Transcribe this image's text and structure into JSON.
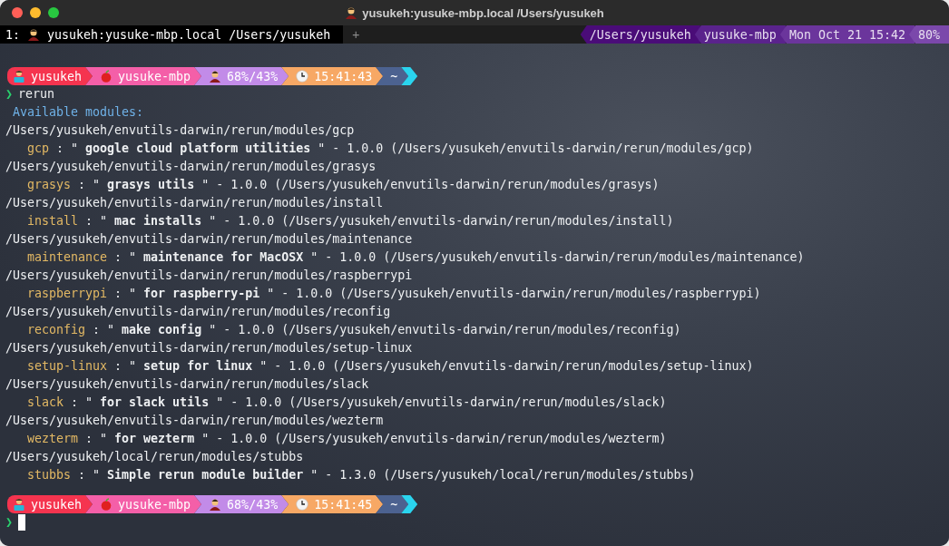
{
  "window": {
    "title": "yusukeh:yusuke-mbp.local /Users/yusukeh"
  },
  "tab_bar": {
    "tabs": [
      {
        "index": "1:",
        "title": "yusukeh:yusuke-mbp.local /Users/yusukeh",
        "selected": true
      }
    ],
    "new_tab": "+",
    "status": [
      {
        "text": "/Users/yusukeh",
        "color": "#4a0c78"
      },
      {
        "text": "yusuke-mbp",
        "color": "#5a238c"
      },
      {
        "text": "Mon Oct 21 15:42",
        "color": "#6b359c"
      },
      {
        "text": "80%",
        "color": "#7b48ab"
      }
    ]
  },
  "prompt": {
    "segments": [
      {
        "kind": "user",
        "text": "yusukeh",
        "color": "#f5344f"
      },
      {
        "kind": "host",
        "text": "yusuke-mbp",
        "color": "#f45fa8"
      },
      {
        "kind": "memory",
        "text": "68%/43%",
        "color": "#c28be8"
      },
      {
        "kind": "time",
        "text": "15:41:43",
        "color": "#f7a865"
      },
      {
        "kind": "dir",
        "text": "~",
        "color": "#4c6290"
      }
    ],
    "symbol": "❯",
    "command": "rerun"
  },
  "heading": "Available modules:",
  "modules": [
    {
      "path": "/Users/yusukeh/envutils-darwin/rerun/modules/gcp",
      "name": "gcp",
      "detail": ": \" **google cloud platform utilities** \" - 1.0.0 (/Users/yusukeh/envutils-darwin/rerun/modules/gcp)"
    },
    {
      "path": "/Users/yusukeh/envutils-darwin/rerun/modules/grasys",
      "name": "grasys",
      "detail": ": \" **grasys utils** \" - 1.0.0 (/Users/yusukeh/envutils-darwin/rerun/modules/grasys)"
    },
    {
      "path": "/Users/yusukeh/envutils-darwin/rerun/modules/install",
      "name": "install",
      "detail": ": \" **mac installs** \" - 1.0.0 (/Users/yusukeh/envutils-darwin/rerun/modules/install)"
    },
    {
      "path": "/Users/yusukeh/envutils-darwin/rerun/modules/maintenance",
      "name": "maintenance",
      "detail": ": \" **maintenance for MacOSX** \" - 1.0.0 (/Users/yusukeh/envutils-darwin/rerun/modules/maintenance)"
    },
    {
      "path": "/Users/yusukeh/envutils-darwin/rerun/modules/raspberrypi",
      "name": "raspberrypi",
      "detail": ": \" **for raspberry-pi** \" - 1.0.0 (/Users/yusukeh/envutils-darwin/rerun/modules/raspberrypi)"
    },
    {
      "path": "/Users/yusukeh/envutils-darwin/rerun/modules/reconfig",
      "name": "reconfig",
      "detail": ": \" **make config** \" - 1.0.0 (/Users/yusukeh/envutils-darwin/rerun/modules/reconfig)"
    },
    {
      "path": "/Users/yusukeh/envutils-darwin/rerun/modules/setup-linux",
      "name": "setup-linux",
      "detail": ": \" **setup for linux** \" - 1.0.0 (/Users/yusukeh/envutils-darwin/rerun/modules/setup-linux)"
    },
    {
      "path": "/Users/yusukeh/envutils-darwin/rerun/modules/slack",
      "name": "slack",
      "detail": ": \" **for slack utils** \" - 1.0.0 (/Users/yusukeh/envutils-darwin/rerun/modules/slack)"
    },
    {
      "path": "/Users/yusukeh/envutils-darwin/rerun/modules/wezterm",
      "name": "wezterm",
      "detail": ": \" **for wezterm** \" - 1.0.0 (/Users/yusukeh/envutils-darwin/rerun/modules/wezterm)"
    },
    {
      "path": "/Users/yusukeh/local/rerun/modules/stubbs",
      "name": "stubbs",
      "detail": ": \" **Simple rerun module builder** \" - 1.3.0 (/Users/yusukeh/local/rerun/modules/stubbs)"
    }
  ],
  "prompt2": {
    "segments": [
      {
        "kind": "user",
        "text": "yusukeh",
        "color": "#f5344f"
      },
      {
        "kind": "host",
        "text": "yusuke-mbp",
        "color": "#f45fa8"
      },
      {
        "kind": "memory",
        "text": "68%/43%",
        "color": "#c28be8"
      },
      {
        "kind": "time",
        "text": "15:41:45",
        "color": "#f7a865"
      },
      {
        "kind": "dir",
        "text": "~",
        "color": "#4c6290"
      }
    ],
    "symbol": "❯",
    "cursor": true
  }
}
